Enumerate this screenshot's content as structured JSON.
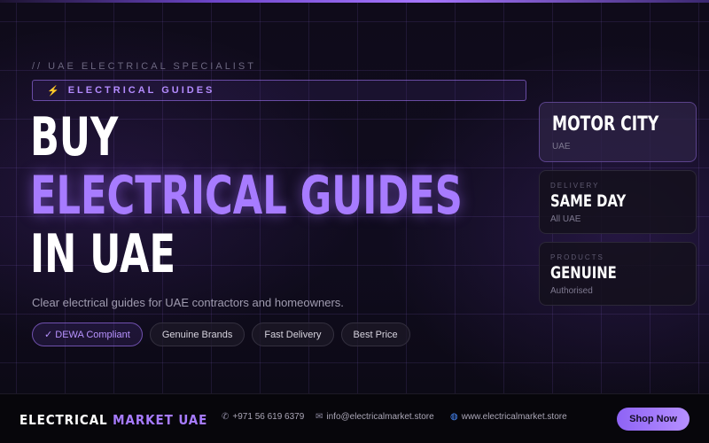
{
  "hero": {
    "eyebrow": "// UAE ELECTRICAL SPECIALIST",
    "category_label": "ELECTRICAL GUIDES",
    "headline_line1": "BUY",
    "headline_line2": "ELECTRICAL GUIDES",
    "headline_line3": "IN UAE",
    "subtitle": "Clear electrical guides for UAE contractors and homeowners.",
    "chips": [
      "✓ DEWA Compliant",
      "Genuine Brands",
      "Fast Delivery",
      "Best Price"
    ]
  },
  "side_cards": {
    "location": {
      "title": "MOTOR CITY",
      "sub": "UAE"
    },
    "delivery": {
      "kicker": "DELIVERY",
      "title": "SAME DAY",
      "sub": "All UAE"
    },
    "products": {
      "kicker": "PRODUCTS",
      "title": "GENUINE",
      "sub": "Authorised"
    }
  },
  "footer": {
    "brand_part1": "ELECTRICAL",
    "brand_part2": "MARKET UAE",
    "phone": "+971 56 619 6379",
    "email": "info@electricalmarket.store",
    "website": "www.electricalmarket.store",
    "shop_button": "Shop Now"
  },
  "icons": {
    "category": "lightning-bolt-icon",
    "phone": "phone-icon",
    "email": "mail-icon",
    "website": "globe-icon"
  },
  "colors": {
    "accent": "#a77bff",
    "background": "#0c0915",
    "bolt": "#f4c02a"
  }
}
